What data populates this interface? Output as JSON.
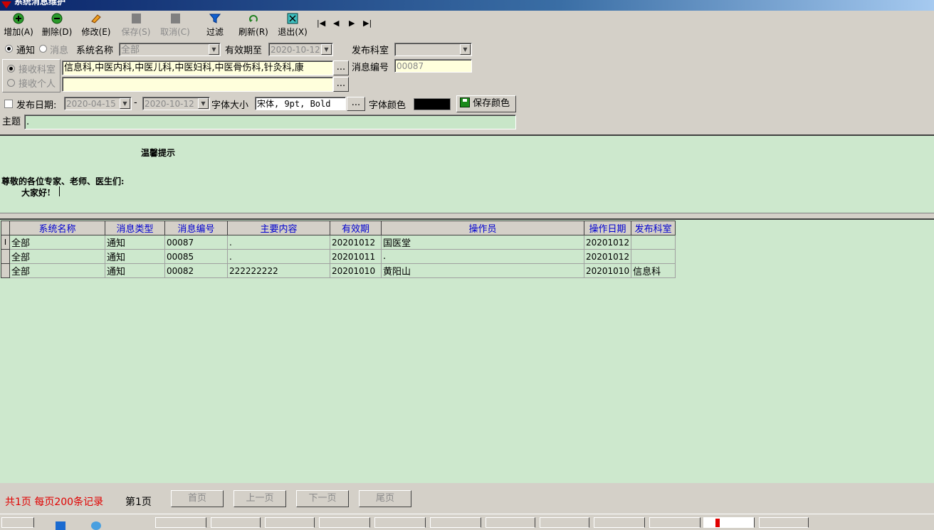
{
  "window": {
    "title": "系统消息维护"
  },
  "toolbar": [
    {
      "label": "增加(A)",
      "icon": "add-icon",
      "enabled": true
    },
    {
      "label": "删除(D)",
      "icon": "delete-icon",
      "enabled": true
    },
    {
      "label": "修改(E)",
      "icon": "edit-icon",
      "enabled": true
    },
    {
      "label": "保存(S)",
      "icon": "save-icon",
      "enabled": false
    },
    {
      "label": "取消(C)",
      "icon": "cancel-icon",
      "enabled": false
    },
    {
      "label": "过滤",
      "icon": "filter-icon",
      "enabled": true
    },
    {
      "label": "刷新(R)",
      "icon": "refresh-icon",
      "enabled": true
    },
    {
      "label": "退出(X)",
      "icon": "exit-icon",
      "enabled": true
    }
  ],
  "nav_glyphs": {
    "first": "|◀",
    "prev": "◀",
    "next": "▶",
    "last": "▶|"
  },
  "form": {
    "radio_notice": "通知",
    "radio_message": "消息",
    "system_name_label": "系统名称",
    "system_name_value": "全部",
    "valid_until_label": "有效期至",
    "valid_until_value": "2020-10-12",
    "publish_dept_label": "发布科室",
    "publish_dept_value": "",
    "recv_dept_label": "接收科室",
    "recv_dept_value": "信息科,中医内科,中医儿科,中医妇科,中医骨伤科,针灸科,康",
    "recv_person_label": "接收个人",
    "recv_person_value": "",
    "msg_no_label": "消息编号",
    "msg_no_value": "00087",
    "ellipsis": "...",
    "publish_date_label": "发布日期:",
    "date_from": "2020-04-15",
    "date_sep": "-",
    "date_to": "2020-10-12",
    "font_size_label": "字体大小",
    "font_value": "宋体, 9pt, Bold",
    "font_color_label": "字体颜色",
    "font_color": "#000000",
    "save_color_label": "保存颜色",
    "subject_label": "主题",
    "subject_value": "."
  },
  "editor": {
    "heading": "温馨提示",
    "line1": "尊敬的各位专家、老师、医生们:",
    "line2": "大家好!"
  },
  "grid": {
    "columns": [
      "系统名称",
      "消息类型",
      "消息编号",
      "主要内容",
      "有效期",
      "操作员",
      "操作日期",
      "发布科室"
    ],
    "rows": [
      [
        "全部",
        "通知",
        "00087",
        ".",
        "20201012",
        "国医堂",
        "20201012",
        ""
      ],
      [
        "全部",
        "通知",
        "00085",
        ".",
        "20201011",
        ".",
        "20201012",
        ""
      ],
      [
        "全部",
        "通知",
        "00082",
        "222222222",
        "20201010",
        "黄阳山",
        "20201010",
        "信息科"
      ]
    ],
    "current_row_marker": "I"
  },
  "status": {
    "summary": "共1页 每页200条记录",
    "page": "第1页",
    "first": "首页",
    "prev": "上一页",
    "next": "下一页",
    "last": "尾页"
  },
  "colors": {
    "panel": "#d4d0c8",
    "editor_bg": "#cde8cd",
    "header_text": "#0000d0",
    "status_red": "#e00000"
  }
}
